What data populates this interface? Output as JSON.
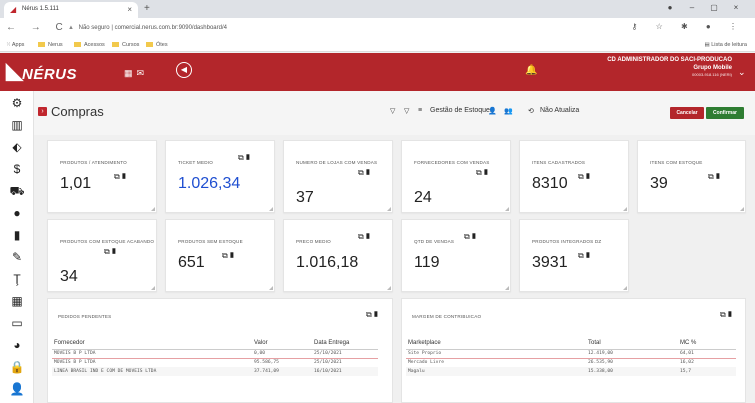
{
  "browser": {
    "tab_title": "Nérus 1.5.111",
    "tab_close": "×",
    "new_tab": "+",
    "window_controls": [
      "●",
      "–",
      "▢",
      "×"
    ],
    "nav_glyphs": "← → C",
    "security": "Não seguro",
    "url": "comercial.nerus.com.br:9090/dashboard/4",
    "right_icons": "⚷ ☆ ✱ ● ⋮",
    "bookmarks": [
      "Apps",
      "Nerus",
      "Acessos",
      "Cursos",
      "Ótes"
    ],
    "reading_list": "Lista de leitura"
  },
  "header": {
    "logo": "NÉRUS",
    "user_name": "CD ADMINISTRADOR DO SACI-PRODUCAO",
    "group": "Grupo Mobile",
    "code": "00003-918.116 (NERI)",
    "accent": "#b3262b"
  },
  "sidebar": {
    "icons": [
      "gear-icon",
      "building-icon",
      "tag-icon",
      "dollar-icon",
      "handcart-icon",
      "group-icon",
      "bar-chart-icon",
      "pencil-icon",
      "tool-icon",
      "grid-icon",
      "monitor-icon",
      "pie-chart-icon",
      "lock-icon",
      "user-icon"
    ]
  },
  "page": {
    "title": "Compras",
    "toolbar": {
      "stock_label": "Gestão de Estoques",
      "no_update": "Não Atualiza",
      "cancel": "Cancelar",
      "confirm": "Confirmar"
    }
  },
  "cards": [
    {
      "label": "PRODUTOS / ATENDIMENTO",
      "value": "1,01"
    },
    {
      "label": "TICKET MEDIO",
      "value": "1.026,34"
    },
    {
      "label": "NUMERO DE LOJAS COM VENDAS",
      "value": "37"
    },
    {
      "label": "FORNECEDORES COM VENDAS",
      "value": "24"
    },
    {
      "label": "ITENS CADASTRADOS",
      "value": "8310"
    },
    {
      "label": "ITENS COM ESTOQUE",
      "value": "39"
    },
    {
      "label": "PRODUTOS COM ESTOQUE ACABANDO",
      "value": "34"
    },
    {
      "label": "PRODUTOS SEM ESTOQUE",
      "value": "651"
    },
    {
      "label": "PRECO MEDIO",
      "value": "1.016,18"
    },
    {
      "label": "QTD DE VENDAS",
      "value": "119"
    },
    {
      "label": "PRODUTOS INTEGRADOS DZ",
      "value": "3931"
    }
  ],
  "pedidos": {
    "title": "PEDIDOS PENDENTES",
    "headers": [
      "Fornecedor",
      "Valor",
      "Data Entrega"
    ],
    "rows": [
      [
        "MOVEIS B P LTDA",
        "0,00",
        "25/10/2021"
      ],
      [
        "MOVEIS B P LTDA",
        "95.586,75",
        "25/10/2021"
      ],
      [
        "LINEA BRASIL IND E COM DE MOVEIS LTDA",
        "37.741,09",
        "16/10/2021"
      ]
    ]
  },
  "margem": {
    "title": "MARGEM DE CONTRIBUICAO",
    "headers": [
      "Marketplace",
      "Total",
      "MC %"
    ],
    "rows": [
      [
        "Site Proprio",
        "12.419,00",
        "64,01"
      ],
      [
        "Mercado Livre",
        "26.535,90",
        "16,02"
      ],
      [
        "Magalu",
        "15.338,00",
        "15,7"
      ]
    ]
  }
}
